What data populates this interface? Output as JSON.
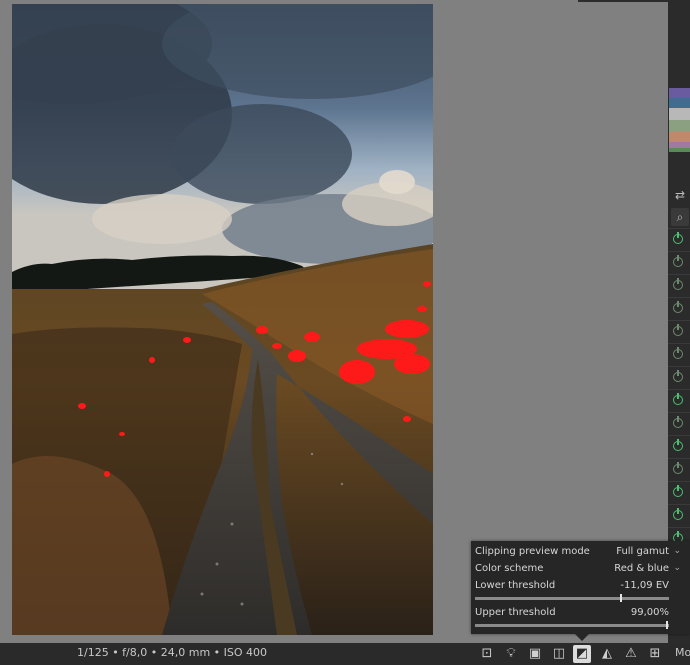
{
  "photo": {
    "description_icon": "photo-image"
  },
  "statusbar": {
    "exif": "1/125 • f/8,0 • 24,0 mm • ISO 400",
    "more_label": "Mo"
  },
  "bottom_icons": [
    "focus-peaking-icon",
    "lightbulb-icon",
    "film-strip-icon",
    "display-profile-icon",
    "clipping-toggle-icon",
    "softproof-icon",
    "gamut-check-icon",
    "grid-icon"
  ],
  "clipping_popup": {
    "mode_label": "Clipping preview mode",
    "mode_value": "Full gamut",
    "scheme_label": "Color scheme",
    "scheme_value": "Red & blue",
    "lower_label": "Lower threshold",
    "lower_value": "-11,09 EV",
    "lower_fraction": 0.75,
    "upper_label": "Upper threshold",
    "upper_value": "99,00%",
    "upper_fraction": 0.99
  },
  "modules": {
    "states": [
      "on",
      "off",
      "off",
      "off",
      "off",
      "off",
      "off",
      "on",
      "off",
      "on",
      "off",
      "on",
      "on",
      "on"
    ]
  }
}
